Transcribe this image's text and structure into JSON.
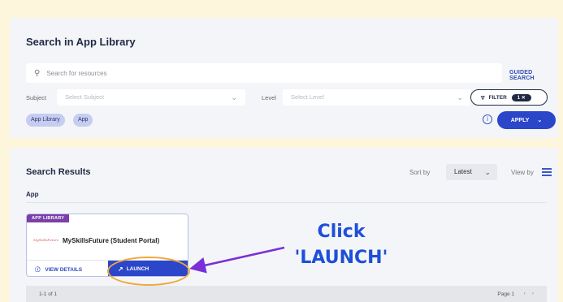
{
  "search": {
    "title": "Search in App Library",
    "placeholder": "Search for resources",
    "guided_search": "GUIDED SEARCH",
    "subject_label": "Subject",
    "subject_placeholder": "Select Subject",
    "level_label": "Level",
    "level_placeholder": "Select Level",
    "filter_label": "FILTER",
    "filter_count": "1",
    "chips": [
      "App Library",
      "App"
    ],
    "apply_label": "APPLY"
  },
  "results": {
    "title": "Search Results",
    "sort_label": "Sort by",
    "sort_value": "Latest",
    "view_label": "View by",
    "group_title": "App",
    "card": {
      "tag": "APP LIBRARY",
      "name": "MySkillsFuture (Student Portal)",
      "view_details": "VIEW DETAILS",
      "launch": "LAUNCH"
    },
    "pager": {
      "count": "1-1 of 1",
      "page": "Page 1"
    }
  },
  "callout": {
    "line1": "Click",
    "line2": "'LAUNCH'",
    "color": "#1e4fd8"
  },
  "icons": {
    "search": "search-icon",
    "filter": "filter-icon",
    "info": "info-icon",
    "launch": "external-link-icon",
    "grid": "list-view-icon"
  }
}
